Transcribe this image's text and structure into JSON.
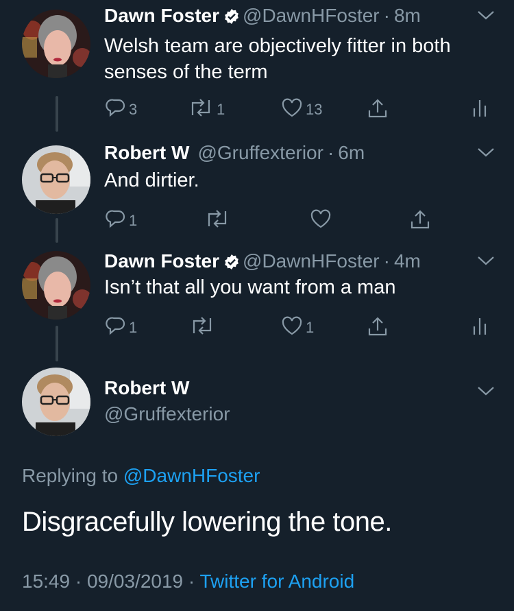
{
  "colors": {
    "background": "#15202b",
    "secondary_text": "#8899a6",
    "link": "#1da1f2",
    "thread_line": "#38444d"
  },
  "tweets": [
    {
      "name": "Dawn Foster",
      "verified": true,
      "handle": "@DawnHFoster",
      "separator": "·",
      "time": "8m",
      "text_lines": [
        "Welsh team are objectively fitter in both",
        "senses of the term"
      ],
      "replies": "3",
      "retweets": "1",
      "likes": "13",
      "show_analytics": true
    },
    {
      "name": "Robert W",
      "verified": false,
      "handle": "@Gruffexterior",
      "separator": "·",
      "time": "6m",
      "text_lines": [
        "And dirtier."
      ],
      "replies": "1",
      "retweets": "",
      "likes": "",
      "show_analytics": false
    },
    {
      "name": "Dawn Foster",
      "verified": true,
      "handle": "@DawnHFoster",
      "separator": "·",
      "time": "4m",
      "text_lines": [
        "Isn’t that all you want from a man"
      ],
      "replies": "1",
      "retweets": "",
      "likes": "1",
      "show_analytics": true
    }
  ],
  "main_tweet": {
    "name": "Robert W",
    "handle": "@Gruffexterior",
    "replying_prefix": "Replying to",
    "replying_to": "@DawnHFoster",
    "text": "Disgracefully lowering the tone.",
    "time": "15:49",
    "separator": "·",
    "date": "09/03/2019",
    "source": "Twitter for Android"
  },
  "icons": {
    "reply": "reply-icon",
    "retweet": "retweet-icon",
    "like": "heart-icon",
    "share": "share-icon",
    "analytics": "analytics-icon",
    "caret": "chevron-down-icon",
    "verified": "verified-badge-icon"
  }
}
